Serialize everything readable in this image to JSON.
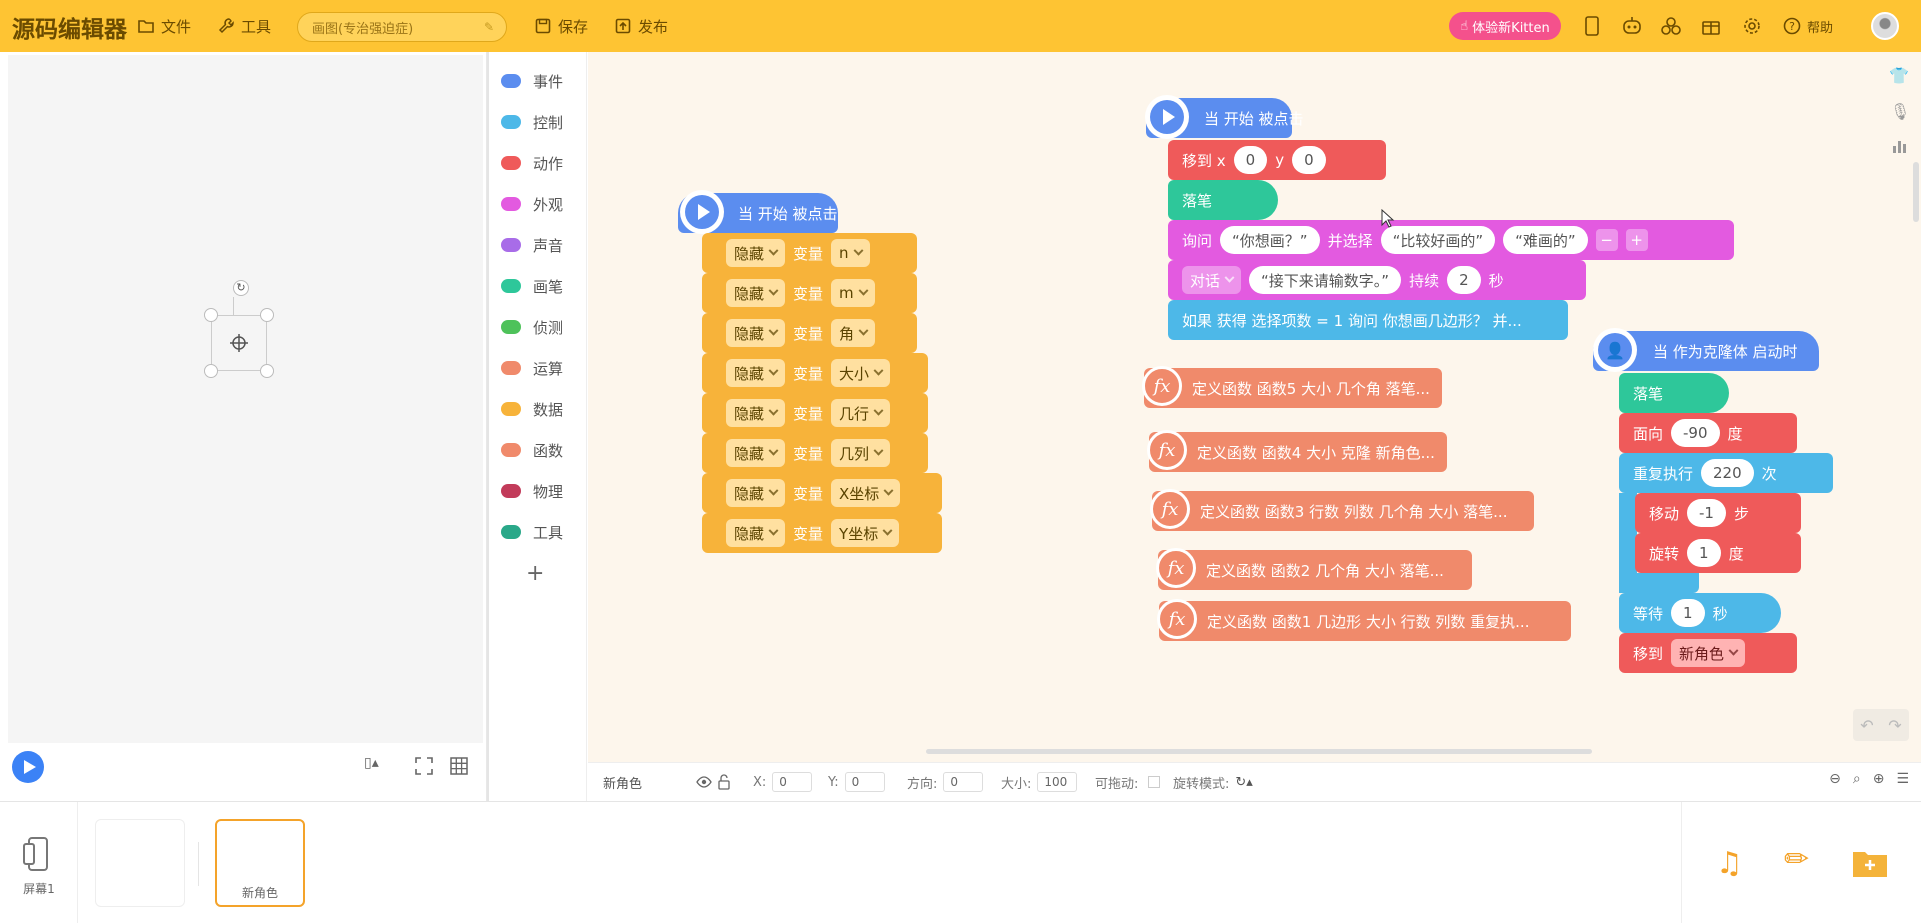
{
  "topbar": {
    "logo": "源码编辑器",
    "file_label": "文件",
    "tools_label": "工具",
    "project_name": "画图(专治强迫症)",
    "save_label": "保存",
    "publish_label": "发布",
    "kitten_label": "体验新Kitten",
    "help_label": "帮助",
    "bg_color": "#fec433",
    "kitten_color": "#f4518c"
  },
  "categories": [
    {
      "label": "事件",
      "color": "#5b8def"
    },
    {
      "label": "控制",
      "color": "#4db8e8"
    },
    {
      "label": "动作",
      "color": "#ef5a5a"
    },
    {
      "label": "外观",
      "color": "#e35ae0"
    },
    {
      "label": "声音",
      "color": "#a86ce8"
    },
    {
      "label": "画笔",
      "color": "#2ec79a"
    },
    {
      "label": "侦测",
      "color": "#4ec25a"
    },
    {
      "label": "运算",
      "color": "#f08a6b"
    },
    {
      "label": "数据",
      "color": "#f7b33a"
    },
    {
      "label": "函数",
      "color": "#f08a6b"
    },
    {
      "label": "物理",
      "color": "#c23b5a"
    },
    {
      "label": "工具",
      "color": "#2aa889"
    }
  ],
  "script1": {
    "hat": "当 开始 被点击",
    "rows": [
      {
        "action": "隐藏",
        "word": "变量",
        "var": "n"
      },
      {
        "action": "隐藏",
        "word": "变量",
        "var": "m"
      },
      {
        "action": "隐藏",
        "word": "变量",
        "var": "角"
      },
      {
        "action": "隐藏",
        "word": "变量",
        "var": "大小"
      },
      {
        "action": "隐藏",
        "word": "变量",
        "var": "几行"
      },
      {
        "action": "隐藏",
        "word": "变量",
        "var": "几列"
      },
      {
        "action": "隐藏",
        "word": "变量",
        "var": "X坐标"
      },
      {
        "action": "隐藏",
        "word": "变量",
        "var": "Y坐标"
      }
    ]
  },
  "script2": {
    "hat": "当 开始 被点击",
    "move": {
      "label": "移到 x",
      "x": "0",
      "ylabel": "y",
      "y": "0"
    },
    "pen_down": "落笔",
    "ask": {
      "label": "询问",
      "q": "“你想画？”",
      "and": "并选择",
      "opt1": "“比较好画的”",
      "opt2": "“难画的”"
    },
    "say": {
      "dd": "对话",
      "text": "“接下来请输数字。”",
      "for": "持续",
      "secs": "2",
      "unit": "秒"
    },
    "if": "如果 获得 选择项数 = 1 询问 你想画几边形？ 并..."
  },
  "functions": [
    {
      "label": "定义函数 函数5   大小 几个角 落笔..."
    },
    {
      "label": "定义函数 函数4   大小 克隆 新角色..."
    },
    {
      "label": "定义函数 函数3   行数 列数 几个角 大小 落笔..."
    },
    {
      "label": "定义函数 函数2   几个角 大小 落笔..."
    },
    {
      "label": "定义函数 函数1   几边形 大小 行数 列数 重复执..."
    }
  ],
  "script3": {
    "hat": "当 作为克隆体 启动时",
    "pen_down": "落笔",
    "face": {
      "label": "面向",
      "val": "-90",
      "unit": "度"
    },
    "repeat": {
      "label": "重复执行",
      "val": "220",
      "unit": "次"
    },
    "move": {
      "label": "移动",
      "val": "-1",
      "unit": "步"
    },
    "turn": {
      "label": "旋转",
      "val": "1",
      "unit": "度"
    },
    "wait": {
      "label": "等待",
      "val": "1",
      "unit": "秒"
    },
    "goto": {
      "label": "移到",
      "target": "新角色"
    }
  },
  "propbar": {
    "sprite_name": "新角色",
    "x_label": "X:",
    "x_val": "0",
    "y_label": "Y:",
    "y_val": "0",
    "dir_label": "方向:",
    "dir_val": "0",
    "size_label": "大小:",
    "size_val": "100",
    "drag_label": "可拖动:",
    "rot_label": "旋转模式:"
  },
  "spritebar": {
    "screen_label": "屏幕1",
    "sprite_label": "新角色"
  }
}
